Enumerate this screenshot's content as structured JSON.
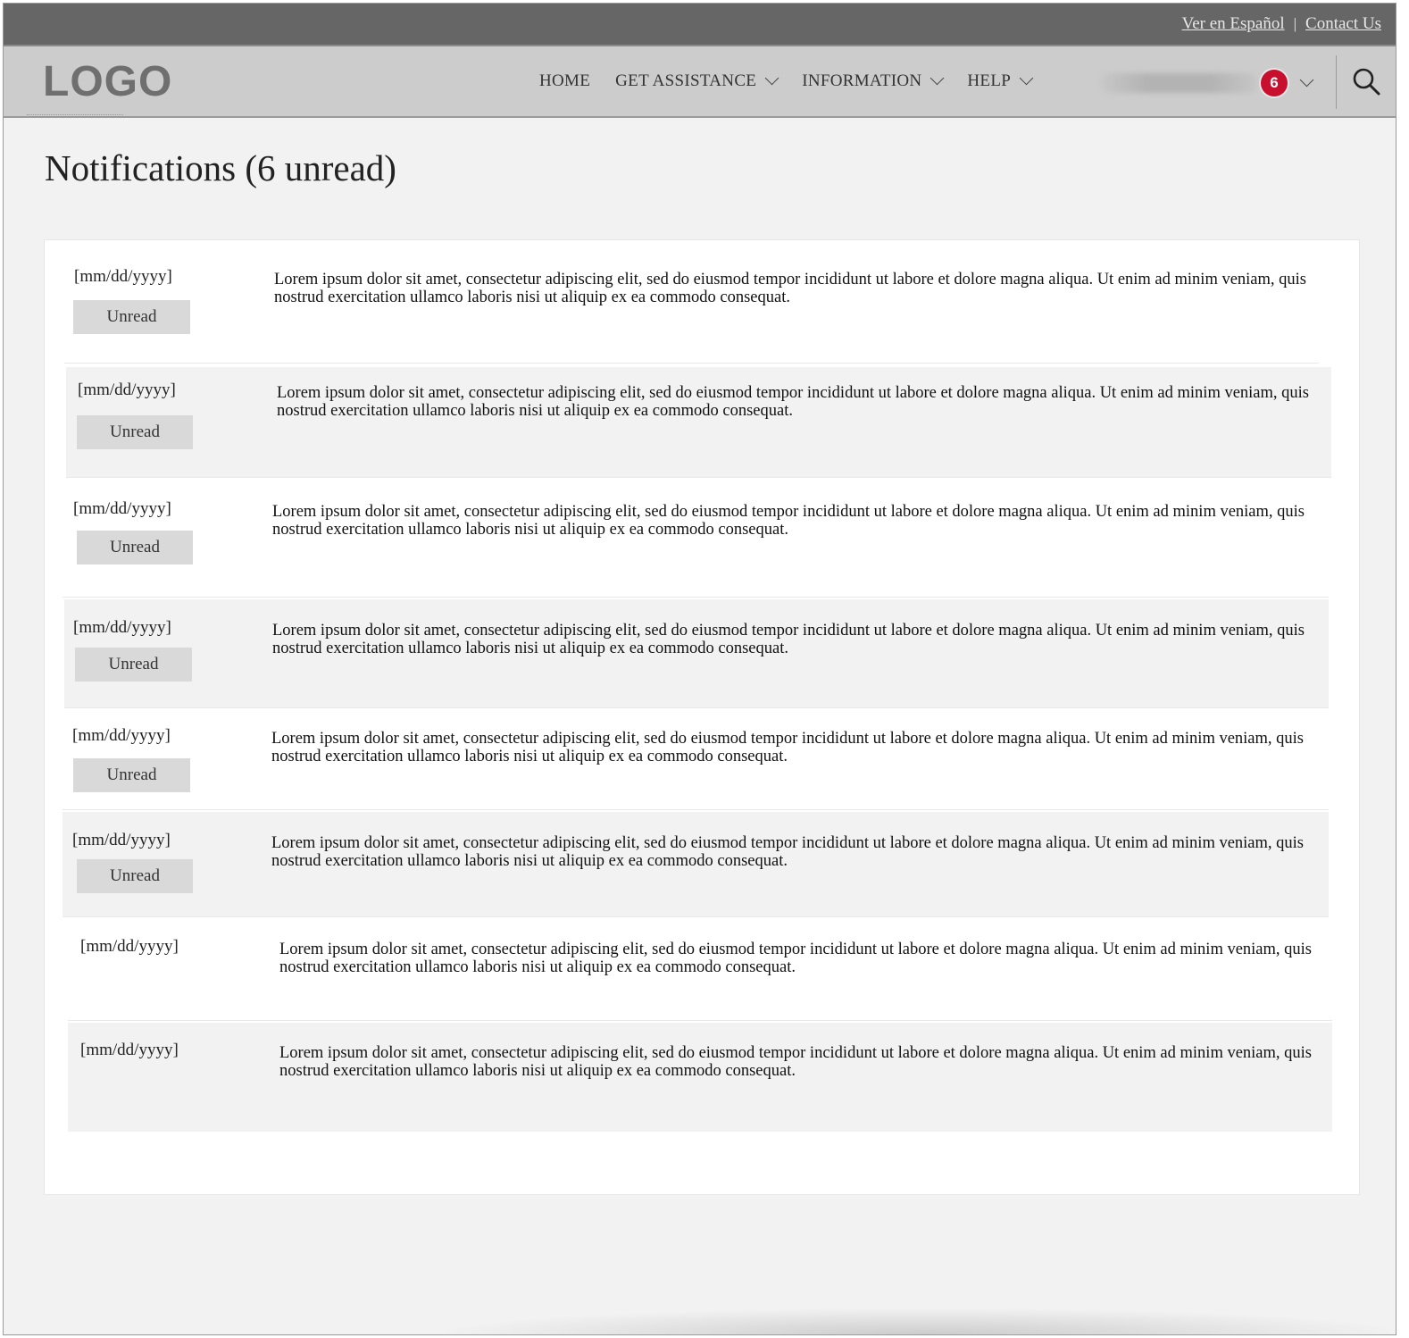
{
  "utility": {
    "spanish_link": "Ver en Español",
    "separator": "|",
    "contact_link": "Contact Us"
  },
  "header": {
    "logo": "LOGO",
    "nav": [
      {
        "label": "HOME",
        "has_dropdown": false
      },
      {
        "label": "GET ASSISTANCE",
        "has_dropdown": true
      },
      {
        "label": "INFORMATION",
        "has_dropdown": true
      },
      {
        "label": "HELP",
        "has_dropdown": true
      }
    ],
    "notification_count": "6",
    "icons": {
      "search": "search-icon",
      "dropdown": "chevron-down-icon"
    },
    "badge_color": "#c8102e"
  },
  "page": {
    "title": "Notifications (6 unread)"
  },
  "notifications": [
    {
      "date": "[mm/dd/yyyy]",
      "status": "Unread",
      "message": "Lorem ipsum dolor sit amet, consectetur adipiscing elit, sed do eiusmod tempor incididunt ut labore et dolore magna aliqua. Ut enim ad minim veniam, quis nostrud exercitation ullamco laboris nisi ut aliquip ex ea commodo consequat."
    },
    {
      "date": "[mm/dd/yyyy]",
      "status": "Unread",
      "message": "Lorem ipsum dolor sit amet, consectetur adipiscing elit, sed do eiusmod tempor incididunt ut labore et dolore magna aliqua. Ut enim ad minim veniam, quis nostrud exercitation ullamco laboris nisi ut aliquip ex ea commodo consequat."
    },
    {
      "date": "[mm/dd/yyyy]",
      "status": "Unread",
      "message": "Lorem ipsum dolor sit amet, consectetur adipiscing elit, sed do eiusmod tempor incididunt ut labore et dolore magna aliqua. Ut enim ad minim veniam, quis nostrud exercitation ullamco laboris nisi ut aliquip ex ea commodo consequat."
    },
    {
      "date": "[mm/dd/yyyy]",
      "status": "Unread",
      "message": "Lorem ipsum dolor sit amet, consectetur adipiscing elit, sed do eiusmod tempor incididunt ut labore et dolore magna aliqua. Ut enim ad minim veniam, quis nostrud exercitation ullamco laboris nisi ut aliquip ex ea commodo consequat."
    },
    {
      "date": "[mm/dd/yyyy]",
      "status": "Unread",
      "message": "Lorem ipsum dolor sit amet, consectetur adipiscing elit, sed do eiusmod tempor incididunt ut labore et dolore magna aliqua. Ut enim ad minim veniam, quis nostrud exercitation ullamco laboris nisi ut aliquip ex ea commodo consequat."
    },
    {
      "date": "[mm/dd/yyyy]",
      "status": "Unread",
      "message": "Lorem ipsum dolor sit amet, consectetur adipiscing elit, sed do eiusmod tempor incididunt ut labore et dolore magna aliqua. Ut enim ad minim veniam, quis nostrud exercitation ullamco laboris nisi ut aliquip ex ea commodo consequat."
    },
    {
      "date": "[mm/dd/yyyy]",
      "message": "Lorem ipsum dolor sit amet, consectetur adipiscing elit, sed do eiusmod tempor incididunt ut labore et dolore magna aliqua. Ut enim ad minim veniam, quis nostrud exercitation ullamco laboris nisi ut aliquip ex ea commodo consequat."
    },
    {
      "date": "[mm/dd/yyyy]",
      "message": "Lorem ipsum dolor sit amet, consectetur adipiscing elit, sed do eiusmod tempor incididunt ut labore et dolore magna aliqua. Ut enim ad minim veniam, quis nostrud exercitation ullamco laboris nisi ut aliquip ex ea commodo consequat."
    }
  ]
}
